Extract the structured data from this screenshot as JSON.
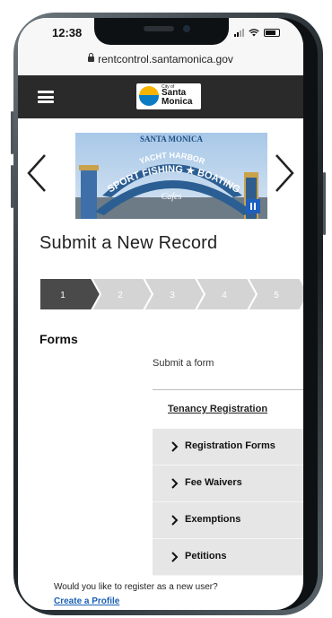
{
  "status_bar": {
    "time": "12:38"
  },
  "browser": {
    "url": "rentcontrol.santamonica.gov"
  },
  "header": {
    "logo": {
      "city_of": "City of",
      "name_line1": "Santa",
      "name_line2": "Monica"
    }
  },
  "banner": {
    "sign_line1": "SANTA MONICA",
    "sign_line2": "YACHT HARBOR",
    "sign_line3": "SPORT FISHING ★ BOATING",
    "sign_line4": "Cafes"
  },
  "page": {
    "title": "Submit a New Record"
  },
  "wizard": {
    "active_step": 1,
    "steps": [
      "1",
      "2",
      "3",
      "4",
      "5"
    ],
    "colors": {
      "active": "#4a4a4a",
      "inactive": "#d4d4d4"
    }
  },
  "forms": {
    "heading": "Forms",
    "submit_label": "Submit a form",
    "tenancy_link": "Tenancy Registration",
    "menu_items": [
      "Registration Forms",
      "Fee Waivers",
      "Exemptions",
      "Petitions"
    ]
  },
  "footer": {
    "register_question": "Would you like to register as a new user?",
    "create_profile_link": "Create a Profile"
  }
}
